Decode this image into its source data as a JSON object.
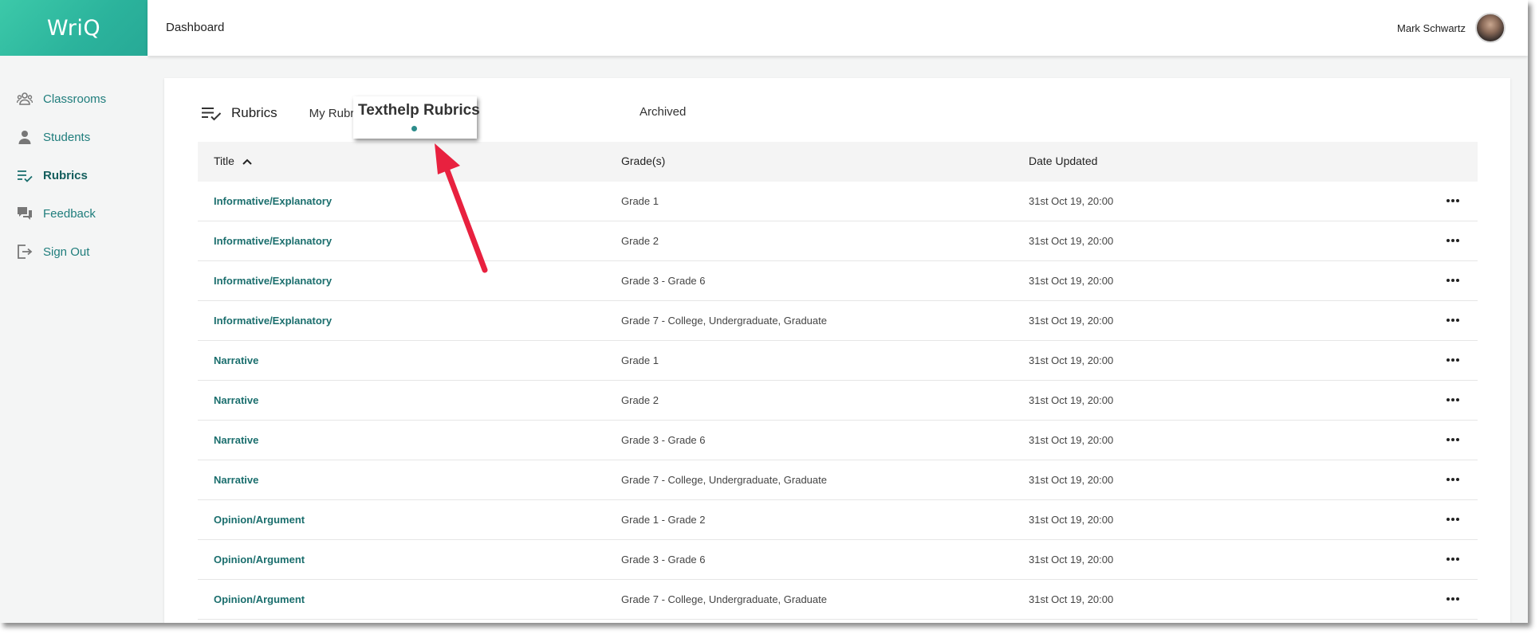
{
  "app": {
    "logo_text": "WriQ",
    "brand_color": "#2bb39c",
    "accent_color": "#1f7d7c"
  },
  "header": {
    "title": "Dashboard",
    "user_name": "Mark Schwartz"
  },
  "sidebar": {
    "items": [
      {
        "label": "Classrooms",
        "icon": "classrooms-icon",
        "active": false
      },
      {
        "label": "Students",
        "icon": "student-icon",
        "active": false
      },
      {
        "label": "Rubrics",
        "icon": "rubrics-icon",
        "active": true
      },
      {
        "label": "Feedback",
        "icon": "feedback-icon",
        "active": false
      },
      {
        "label": "Sign Out",
        "icon": "sign-out-icon",
        "active": false
      }
    ]
  },
  "main": {
    "heading": "Rubrics",
    "tabs": {
      "mine": "My Rubr",
      "texthelp": "Texthelp Rubrics",
      "archived": "Archived"
    },
    "columns": {
      "title": "Title",
      "grades": "Grade(s)",
      "date": "Date Updated"
    },
    "rows": [
      {
        "title": "Informative/Explanatory",
        "grades": "Grade 1",
        "date": "31st Oct 19, 20:00"
      },
      {
        "title": "Informative/Explanatory",
        "grades": "Grade 2",
        "date": "31st Oct 19, 20:00"
      },
      {
        "title": "Informative/Explanatory",
        "grades": "Grade 3 - Grade 6",
        "date": "31st Oct 19, 20:00"
      },
      {
        "title": "Informative/Explanatory",
        "grades": "Grade 7 - College, Undergraduate, Graduate",
        "date": "31st Oct 19, 20:00"
      },
      {
        "title": "Narrative",
        "grades": "Grade 1",
        "date": "31st Oct 19, 20:00"
      },
      {
        "title": "Narrative",
        "grades": "Grade 2",
        "date": "31st Oct 19, 20:00"
      },
      {
        "title": "Narrative",
        "grades": "Grade 3 - Grade 6",
        "date": "31st Oct 19, 20:00"
      },
      {
        "title": "Narrative",
        "grades": "Grade 7 - College, Undergraduate, Graduate",
        "date": "31st Oct 19, 20:00"
      },
      {
        "title": "Opinion/Argument",
        "grades": "Grade 1 - Grade 2",
        "date": "31st Oct 19, 20:00"
      },
      {
        "title": "Opinion/Argument",
        "grades": "Grade 3 - Grade 6",
        "date": "31st Oct 19, 20:00"
      },
      {
        "title": "Opinion/Argument",
        "grades": "Grade 7 - College, Undergraduate, Graduate",
        "date": "31st Oct 19, 20:00"
      }
    ]
  },
  "annotation": {
    "arrow_color": "#e8213f"
  }
}
